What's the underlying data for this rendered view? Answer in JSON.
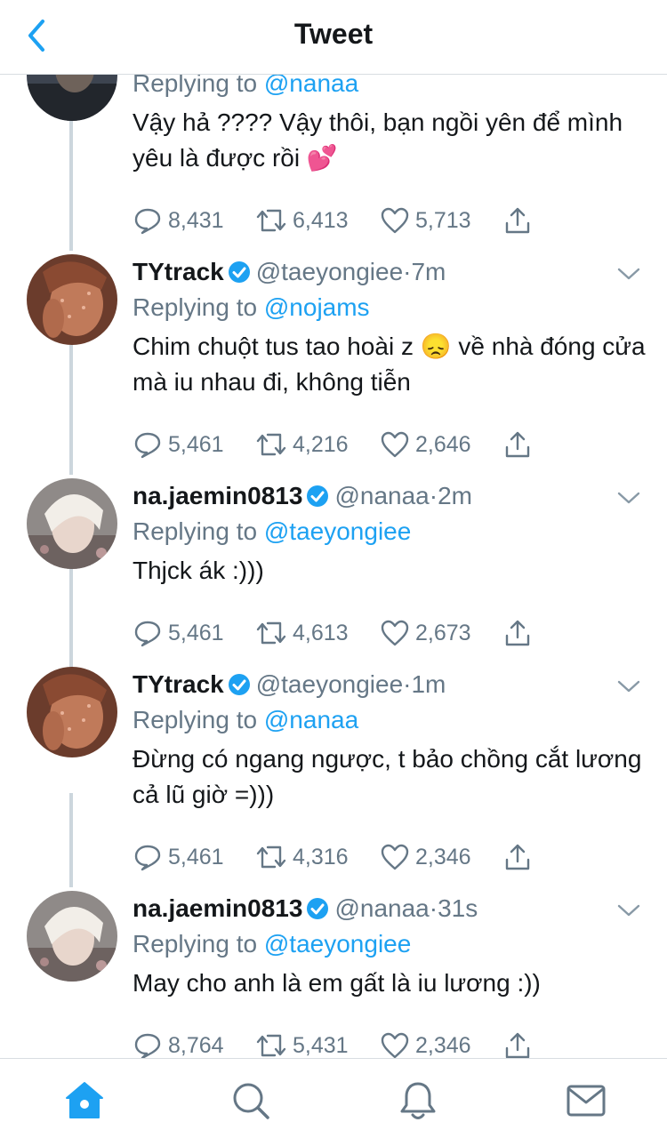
{
  "header": {
    "title": "Tweet"
  },
  "top_tweet": {
    "reply_prefix": "Replying to",
    "reply_to": "@nanaa",
    "text": "Vậy hả ???? Vậy thôi, bạn ngồi yên để mình yêu là được rồi",
    "emoji": "💕",
    "replies": "8,431",
    "retweets": "6,413",
    "likes": "5,713"
  },
  "tweets": [
    {
      "name": "TYtrack",
      "handle": "@taeyongiee",
      "dot": "·",
      "time": "7m",
      "reply_prefix": "Replying to",
      "reply_to": "@nojams",
      "text_1": "Chim chuột tus tao hoài z",
      "emoji": "😞",
      "text_2": "về nhà đóng cửa mà iu nhau đi, không tiễn",
      "replies": "5,461",
      "retweets": "4,216",
      "likes": "2,646"
    },
    {
      "name": "na.jaemin0813",
      "handle": "@nanaa",
      "dot": "·",
      "time": "2m",
      "reply_prefix": "Replying to",
      "reply_to": "@taeyongiee",
      "text": "Thjck ák :)))",
      "replies": "5,461",
      "retweets": "4,613",
      "likes": "2,673"
    },
    {
      "name": "TYtrack",
      "handle": "@taeyongiee",
      "dot": "·",
      "time": "1m",
      "reply_prefix": "Replying to",
      "reply_to": "@nanaa",
      "text": "Đừng có ngang ngược, t bảo chồng cắt lương cả lũ giờ =)))",
      "replies": "5,461",
      "retweets": "4,316",
      "likes": "2,346"
    },
    {
      "name": "na.jaemin0813",
      "handle": "@nanaa",
      "dot": "·",
      "time": "31s",
      "reply_prefix": "Replying to",
      "reply_to": "@taeyongiee",
      "text": "May cho anh là em gất là iu lương :))",
      "replies": "8,764",
      "retweets": "5,431",
      "likes": "2,346"
    }
  ],
  "colors": {
    "accent": "#1da1f2",
    "muted": "#657786",
    "text": "#14171a",
    "thread": "#ccd6dd"
  },
  "tabs": [
    "home-icon",
    "search-icon",
    "notifications-icon",
    "messages-icon"
  ]
}
